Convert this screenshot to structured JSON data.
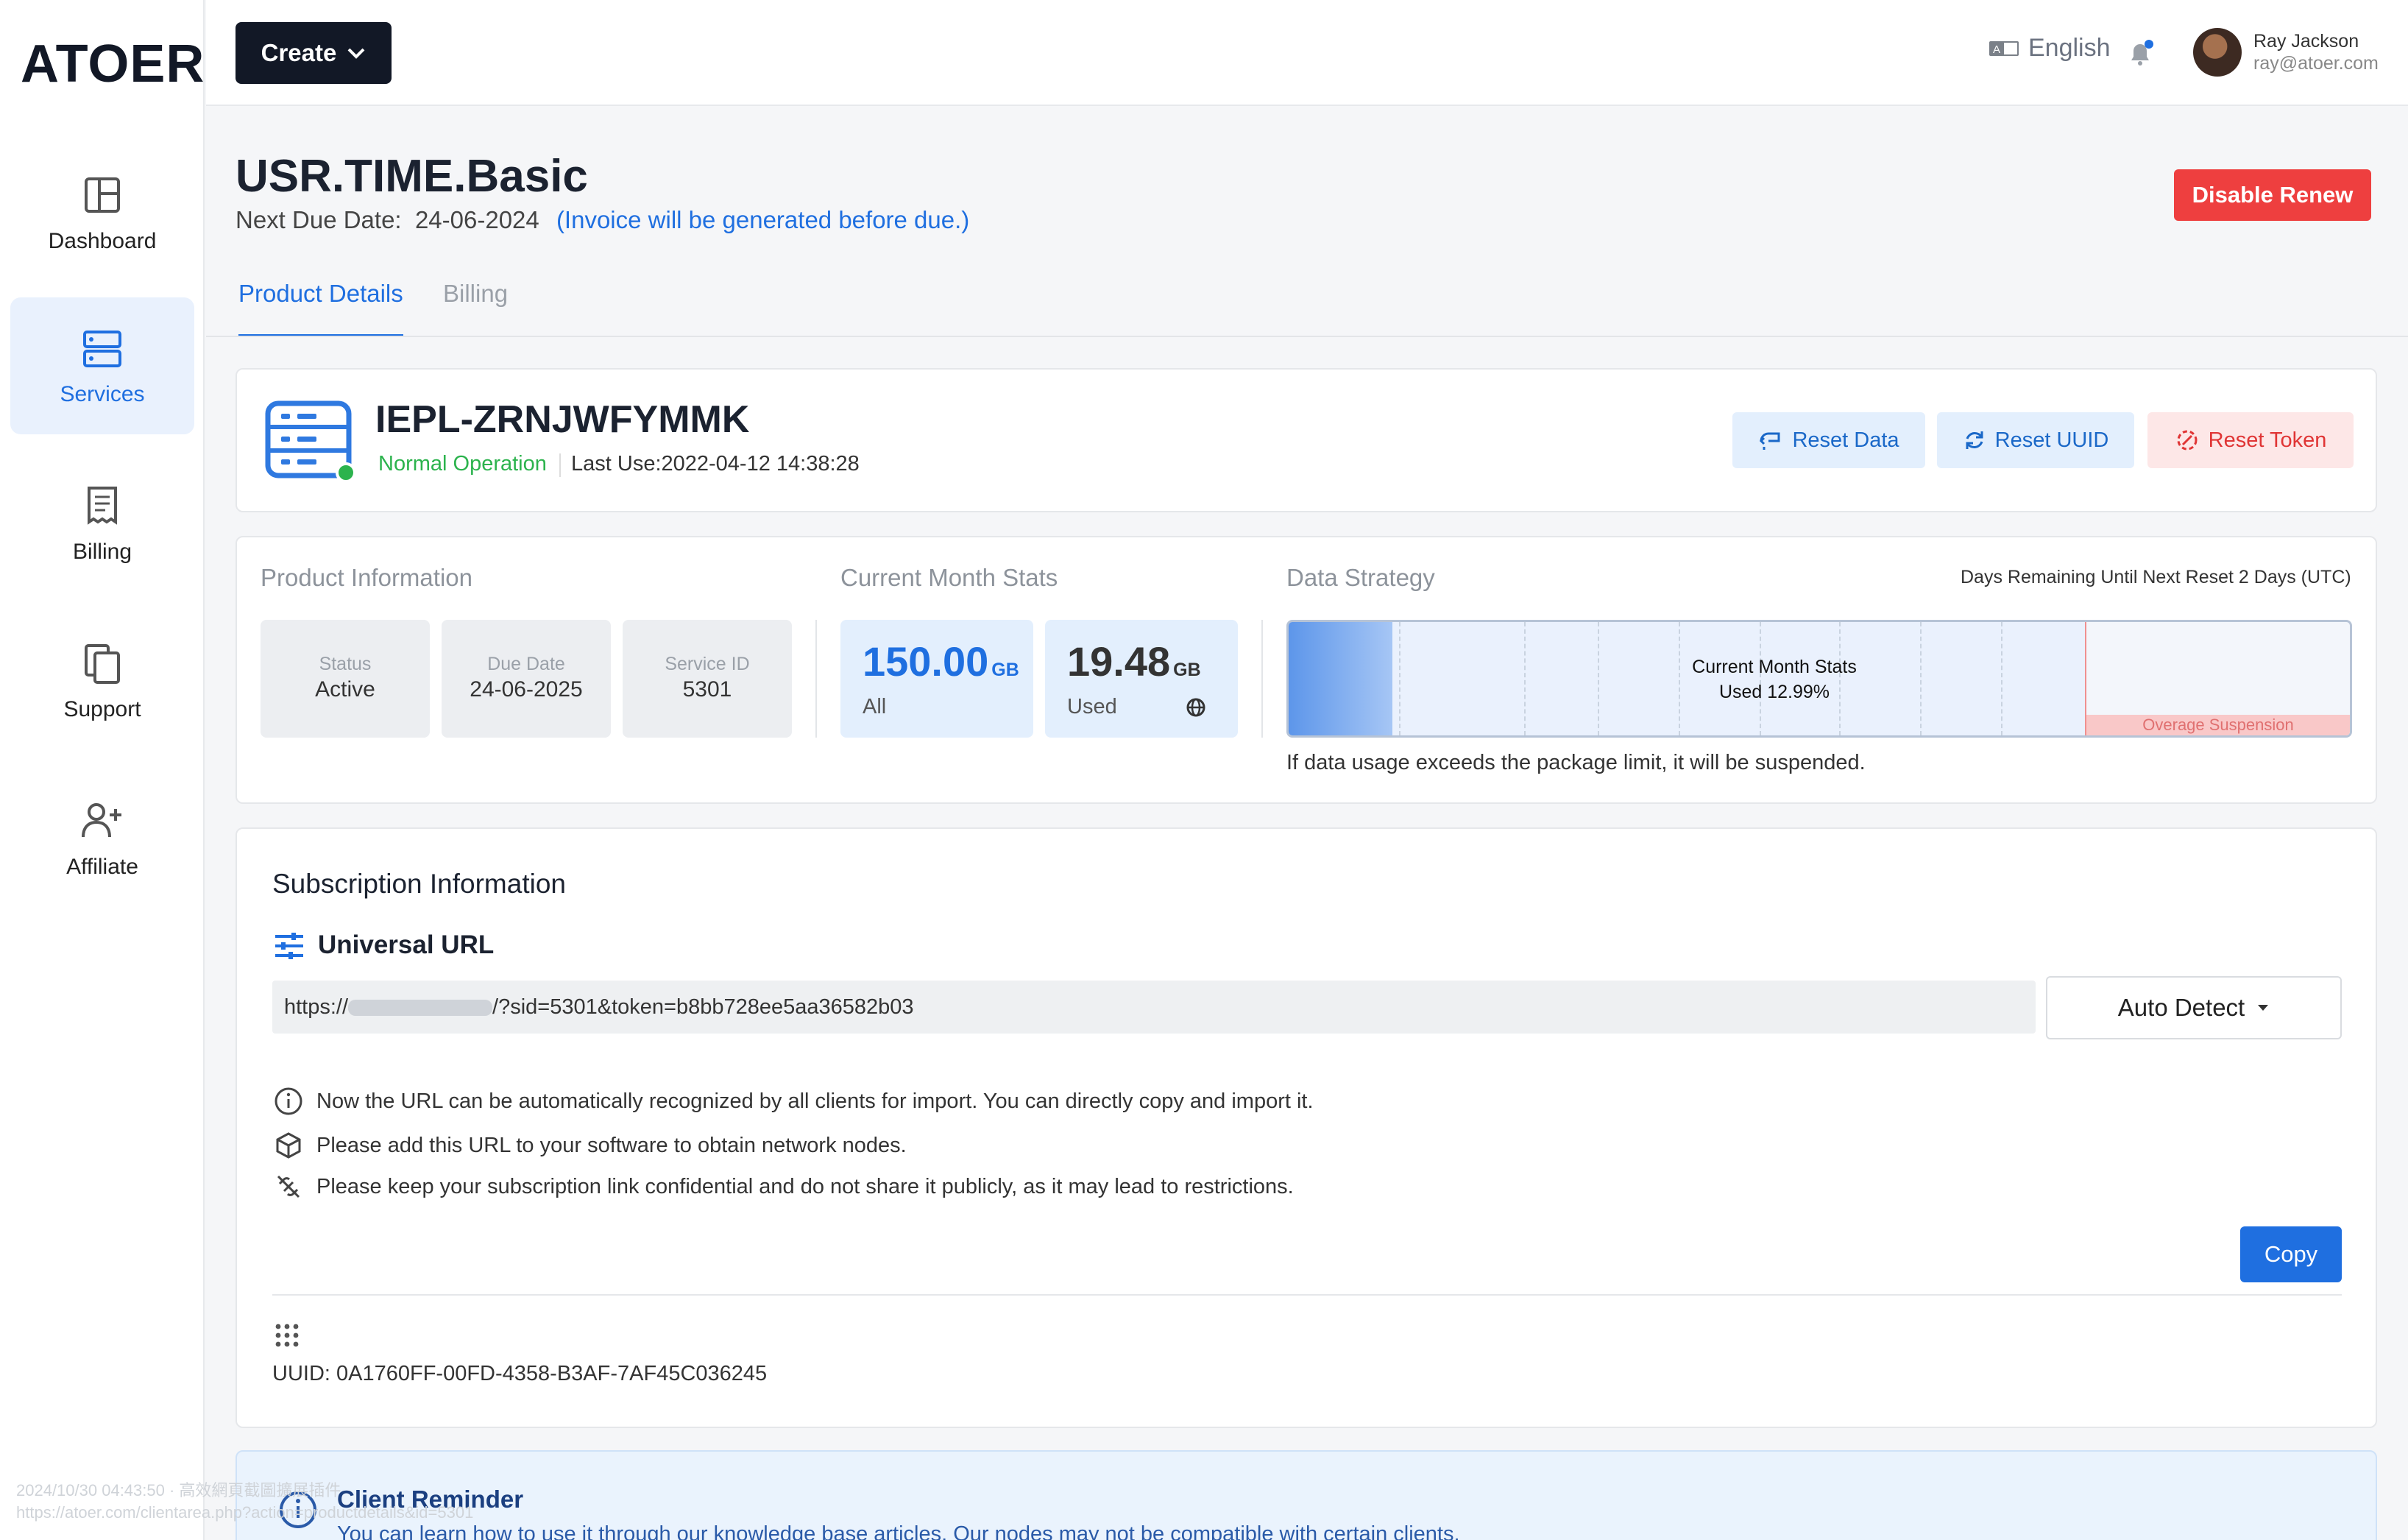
{
  "brand": {
    "logo": "ATOER"
  },
  "sidebar": {
    "items": [
      {
        "label": "Dashboard",
        "icon": "dashboard-icon"
      },
      {
        "label": "Services",
        "icon": "server-icon",
        "active": true
      },
      {
        "label": "Billing",
        "icon": "receipt-icon"
      },
      {
        "label": "Support",
        "icon": "support-icon"
      },
      {
        "label": "Affiliate",
        "icon": "add-user-icon"
      }
    ]
  },
  "header": {
    "create_label": "Create",
    "language": "English",
    "user": {
      "name": "Ray Jackson",
      "email": "ray@atoer.com"
    }
  },
  "page": {
    "title": "USR.TIME.Basic",
    "due_label": "Next Due Date:",
    "due_date": "24-06-2024",
    "due_note": "(Invoice will be generated before due.)",
    "disable_renew": "Disable Renew",
    "tabs": [
      {
        "label": "Product Details",
        "active": true
      },
      {
        "label": "Billing",
        "active": false
      }
    ]
  },
  "service": {
    "name": "IEPL-ZRNJWFYMMK",
    "status": "Normal Operation",
    "last_use": "Last Use:2022-04-12 14:38:28",
    "actions": {
      "reset_data": "Reset Data",
      "reset_uuid": "Reset UUID",
      "reset_token": "Reset Token"
    }
  },
  "product_info": {
    "title": "Product Information",
    "items": [
      {
        "key": "Status",
        "value": "Active"
      },
      {
        "key": "Due Date",
        "value": "24-06-2025"
      },
      {
        "key": "Service ID",
        "value": "5301"
      }
    ]
  },
  "month_stats": {
    "title": "Current Month Stats",
    "all": {
      "value": "150.00",
      "unit": "GB",
      "label": "All"
    },
    "used": {
      "value": "19.48",
      "unit": "GB",
      "label": "Used"
    }
  },
  "data_strategy": {
    "title": "Data Strategy",
    "days_remaining": "Days Remaining Until Next Reset 2 Days (UTC)",
    "bar_title": "Current Month Stats",
    "bar_used": "Used 12.99%",
    "used_fraction": 0.1299,
    "overage_label": "Overage Suspension",
    "note": "If data usage exceeds the package limit, it will be suspended."
  },
  "subscription": {
    "title": "Subscription Information",
    "url_heading": "Universal URL",
    "url_prefix": "https://",
    "url_suffix": "/?sid=5301&token=b8bb728ee5aa36582b03",
    "client_select": "Auto Detect",
    "tips": [
      "Now the URL can be automatically recognized by all clients for import. You can directly copy and import it.",
      "Please add this URL to your software to obtain network nodes.",
      "Please keep your subscription link confidential and do not share it publicly, as it may lead to restrictions."
    ],
    "copy_label": "Copy",
    "uuid": "UUID: 0A1760FF-00FD-4358-B3AF-7AF45C036245"
  },
  "reminder": {
    "title": "Client Reminder",
    "text": "You can learn how to use it through our knowledge base articles. Our nodes may not be compatible with certain clients."
  },
  "watermark": {
    "line1": "2024/10/30 04:43:50 · 高效網頁截圖擴展插件",
    "line2": "https://atoer.com/clientarea.php?action=productdetails&id=5301"
  },
  "colors": {
    "primary": "#1f6fe0",
    "danger": "#ee3f3f",
    "success": "#2cb34d",
    "dark": "#121826"
  }
}
